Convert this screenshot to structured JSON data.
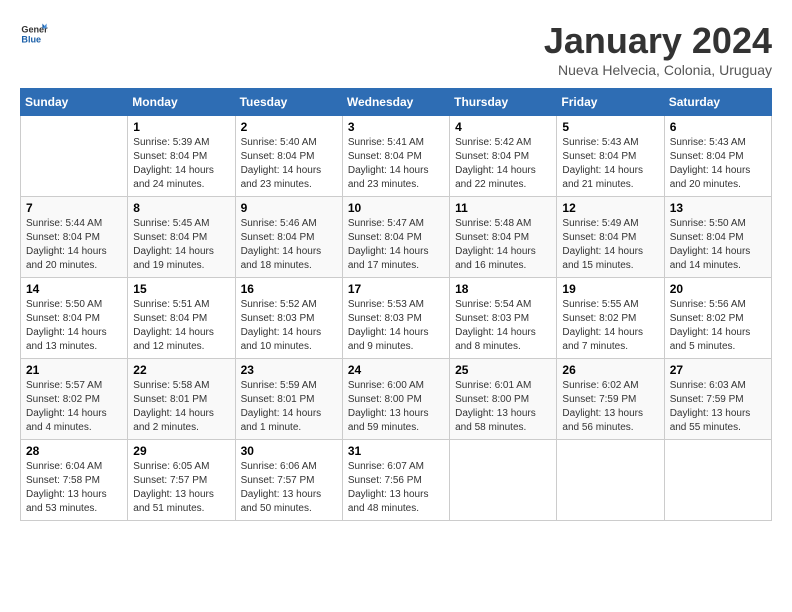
{
  "logo": {
    "general": "General",
    "blue": "Blue"
  },
  "title": "January 2024",
  "subtitle": "Nueva Helvecia, Colonia, Uruguay",
  "weekdays": [
    "Sunday",
    "Monday",
    "Tuesday",
    "Wednesday",
    "Thursday",
    "Friday",
    "Saturday"
  ],
  "weeks": [
    [
      {
        "day": "",
        "sunrise": "",
        "sunset": "",
        "daylight": ""
      },
      {
        "day": "1",
        "sunrise": "Sunrise: 5:39 AM",
        "sunset": "Sunset: 8:04 PM",
        "daylight": "Daylight: 14 hours and 24 minutes."
      },
      {
        "day": "2",
        "sunrise": "Sunrise: 5:40 AM",
        "sunset": "Sunset: 8:04 PM",
        "daylight": "Daylight: 14 hours and 23 minutes."
      },
      {
        "day": "3",
        "sunrise": "Sunrise: 5:41 AM",
        "sunset": "Sunset: 8:04 PM",
        "daylight": "Daylight: 14 hours and 23 minutes."
      },
      {
        "day": "4",
        "sunrise": "Sunrise: 5:42 AM",
        "sunset": "Sunset: 8:04 PM",
        "daylight": "Daylight: 14 hours and 22 minutes."
      },
      {
        "day": "5",
        "sunrise": "Sunrise: 5:43 AM",
        "sunset": "Sunset: 8:04 PM",
        "daylight": "Daylight: 14 hours and 21 minutes."
      },
      {
        "day": "6",
        "sunrise": "Sunrise: 5:43 AM",
        "sunset": "Sunset: 8:04 PM",
        "daylight": "Daylight: 14 hours and 20 minutes."
      }
    ],
    [
      {
        "day": "7",
        "sunrise": "Sunrise: 5:44 AM",
        "sunset": "Sunset: 8:04 PM",
        "daylight": "Daylight: 14 hours and 20 minutes."
      },
      {
        "day": "8",
        "sunrise": "Sunrise: 5:45 AM",
        "sunset": "Sunset: 8:04 PM",
        "daylight": "Daylight: 14 hours and 19 minutes."
      },
      {
        "day": "9",
        "sunrise": "Sunrise: 5:46 AM",
        "sunset": "Sunset: 8:04 PM",
        "daylight": "Daylight: 14 hours and 18 minutes."
      },
      {
        "day": "10",
        "sunrise": "Sunrise: 5:47 AM",
        "sunset": "Sunset: 8:04 PM",
        "daylight": "Daylight: 14 hours and 17 minutes."
      },
      {
        "day": "11",
        "sunrise": "Sunrise: 5:48 AM",
        "sunset": "Sunset: 8:04 PM",
        "daylight": "Daylight: 14 hours and 16 minutes."
      },
      {
        "day": "12",
        "sunrise": "Sunrise: 5:49 AM",
        "sunset": "Sunset: 8:04 PM",
        "daylight": "Daylight: 14 hours and 15 minutes."
      },
      {
        "day": "13",
        "sunrise": "Sunrise: 5:50 AM",
        "sunset": "Sunset: 8:04 PM",
        "daylight": "Daylight: 14 hours and 14 minutes."
      }
    ],
    [
      {
        "day": "14",
        "sunrise": "Sunrise: 5:50 AM",
        "sunset": "Sunset: 8:04 PM",
        "daylight": "Daylight: 14 hours and 13 minutes."
      },
      {
        "day": "15",
        "sunrise": "Sunrise: 5:51 AM",
        "sunset": "Sunset: 8:04 PM",
        "daylight": "Daylight: 14 hours and 12 minutes."
      },
      {
        "day": "16",
        "sunrise": "Sunrise: 5:52 AM",
        "sunset": "Sunset: 8:03 PM",
        "daylight": "Daylight: 14 hours and 10 minutes."
      },
      {
        "day": "17",
        "sunrise": "Sunrise: 5:53 AM",
        "sunset": "Sunset: 8:03 PM",
        "daylight": "Daylight: 14 hours and 9 minutes."
      },
      {
        "day": "18",
        "sunrise": "Sunrise: 5:54 AM",
        "sunset": "Sunset: 8:03 PM",
        "daylight": "Daylight: 14 hours and 8 minutes."
      },
      {
        "day": "19",
        "sunrise": "Sunrise: 5:55 AM",
        "sunset": "Sunset: 8:02 PM",
        "daylight": "Daylight: 14 hours and 7 minutes."
      },
      {
        "day": "20",
        "sunrise": "Sunrise: 5:56 AM",
        "sunset": "Sunset: 8:02 PM",
        "daylight": "Daylight: 14 hours and 5 minutes."
      }
    ],
    [
      {
        "day": "21",
        "sunrise": "Sunrise: 5:57 AM",
        "sunset": "Sunset: 8:02 PM",
        "daylight": "Daylight: 14 hours and 4 minutes."
      },
      {
        "day": "22",
        "sunrise": "Sunrise: 5:58 AM",
        "sunset": "Sunset: 8:01 PM",
        "daylight": "Daylight: 14 hours and 2 minutes."
      },
      {
        "day": "23",
        "sunrise": "Sunrise: 5:59 AM",
        "sunset": "Sunset: 8:01 PM",
        "daylight": "Daylight: 14 hours and 1 minute."
      },
      {
        "day": "24",
        "sunrise": "Sunrise: 6:00 AM",
        "sunset": "Sunset: 8:00 PM",
        "daylight": "Daylight: 13 hours and 59 minutes."
      },
      {
        "day": "25",
        "sunrise": "Sunrise: 6:01 AM",
        "sunset": "Sunset: 8:00 PM",
        "daylight": "Daylight: 13 hours and 58 minutes."
      },
      {
        "day": "26",
        "sunrise": "Sunrise: 6:02 AM",
        "sunset": "Sunset: 7:59 PM",
        "daylight": "Daylight: 13 hours and 56 minutes."
      },
      {
        "day": "27",
        "sunrise": "Sunrise: 6:03 AM",
        "sunset": "Sunset: 7:59 PM",
        "daylight": "Daylight: 13 hours and 55 minutes."
      }
    ],
    [
      {
        "day": "28",
        "sunrise": "Sunrise: 6:04 AM",
        "sunset": "Sunset: 7:58 PM",
        "daylight": "Daylight: 13 hours and 53 minutes."
      },
      {
        "day": "29",
        "sunrise": "Sunrise: 6:05 AM",
        "sunset": "Sunset: 7:57 PM",
        "daylight": "Daylight: 13 hours and 51 minutes."
      },
      {
        "day": "30",
        "sunrise": "Sunrise: 6:06 AM",
        "sunset": "Sunset: 7:57 PM",
        "daylight": "Daylight: 13 hours and 50 minutes."
      },
      {
        "day": "31",
        "sunrise": "Sunrise: 6:07 AM",
        "sunset": "Sunset: 7:56 PM",
        "daylight": "Daylight: 13 hours and 48 minutes."
      },
      {
        "day": "",
        "sunrise": "",
        "sunset": "",
        "daylight": ""
      },
      {
        "day": "",
        "sunrise": "",
        "sunset": "",
        "daylight": ""
      },
      {
        "day": "",
        "sunrise": "",
        "sunset": "",
        "daylight": ""
      }
    ]
  ]
}
